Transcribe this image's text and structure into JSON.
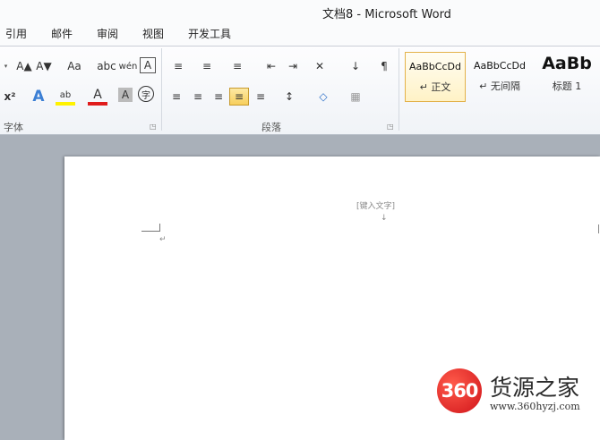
{
  "window": {
    "title": "文档8 - Microsoft Word"
  },
  "tabs": [
    "引用",
    "邮件",
    "审阅",
    "视图",
    "开发工具"
  ],
  "ribbon": {
    "font_group": {
      "label": "字体",
      "row1": [
        "A▲",
        "A▼",
        "Aa",
        "abc",
        "wén",
        "A"
      ],
      "row2": [
        "x²",
        "A",
        "ab",
        "A",
        "A",
        "字"
      ]
    },
    "paragraph_group": {
      "label": "段落",
      "row1": [
        "≡",
        "≡",
        "≡",
        "⇤",
        "⇥",
        "✕",
        "↓",
        "¶"
      ],
      "row2": [
        "≡",
        "≡",
        "≡",
        "≡",
        "≡",
        "↕",
        "◇",
        "▦"
      ]
    },
    "styles_group": {
      "items": [
        {
          "sample": "AaBbCcDd",
          "name": "↵ 正文"
        },
        {
          "sample": "AaBbCcDd",
          "name": "↵ 无间隔"
        },
        {
          "sample": "AaBb",
          "name": "标题 1"
        }
      ]
    }
  },
  "document": {
    "header_placeholder": "[键入文字]",
    "header_mark": "↓",
    "paragraph_mark": "↵"
  },
  "watermark": {
    "badge": "360",
    "name": "货源之家",
    "url": "www.360hyzj.com"
  }
}
